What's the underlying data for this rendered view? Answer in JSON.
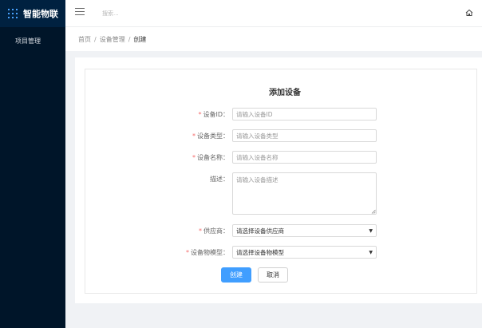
{
  "app": {
    "name": "智能物联"
  },
  "sidebar": {
    "items": [
      {
        "label": "项目管理"
      }
    ]
  },
  "header": {
    "search_placeholder": "搜索..."
  },
  "breadcrumb": {
    "home": "首页",
    "parent": "设备管理",
    "current": "创建",
    "separator": "/"
  },
  "form": {
    "title": "添加设备",
    "required_mark": "*",
    "fields": {
      "device_id": {
        "label": "设备ID：",
        "placeholder": "请输入设备ID",
        "value": ""
      },
      "device_type": {
        "label": "设备类型：",
        "placeholder": "请输入设备类型",
        "value": ""
      },
      "device_name": {
        "label": "设备名称：",
        "placeholder": "请输入设备名称",
        "value": ""
      },
      "description": {
        "label": "描述：",
        "placeholder": "请输入设备描述",
        "value": ""
      },
      "supplier": {
        "label": "供应商：",
        "selected": "请选择设备供应商"
      },
      "model": {
        "label": "设备物模型：",
        "selected": "请选择设备物模型"
      }
    },
    "buttons": {
      "create": "创建",
      "cancel": "取消"
    }
  },
  "colors": {
    "sidebar_bg": "#001529",
    "primary": "#409eff",
    "required": "#f56c6c"
  },
  "icons": {
    "logo": "grid-icon",
    "menu_toggle": "hamburger-icon",
    "home": "home-icon",
    "select_caret": "caret-down-icon"
  }
}
